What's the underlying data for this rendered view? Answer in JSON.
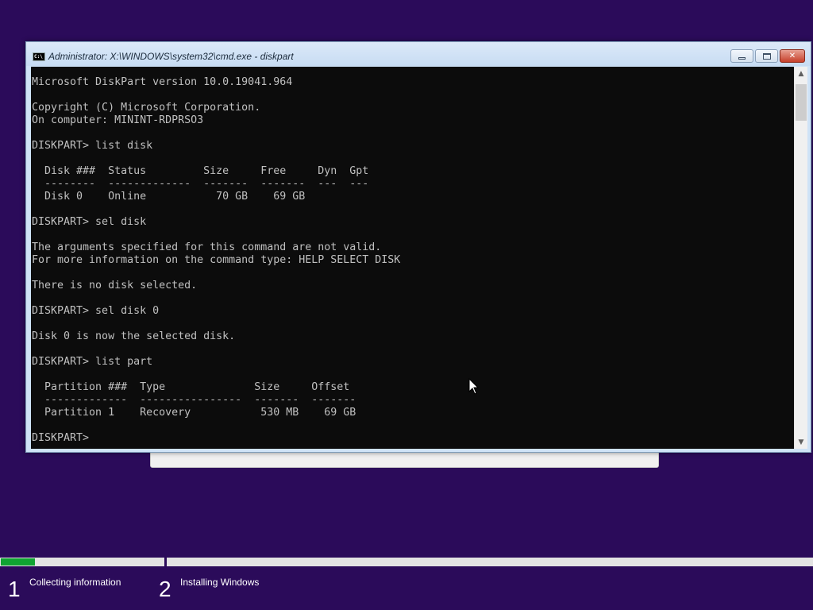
{
  "window": {
    "title": "Administrator: X:\\WINDOWS\\system32\\cmd.exe - diskpart",
    "icon_text": "C:\\",
    "controls": {
      "minimize": "minimize-icon",
      "maximize": "maximize-icon",
      "close": "✕"
    }
  },
  "console": {
    "lines": [
      "Microsoft DiskPart version 10.0.19041.964",
      "",
      "Copyright (C) Microsoft Corporation.",
      "On computer: MININT-RDPRSO3",
      "",
      "DISKPART> list disk",
      "",
      "  Disk ###  Status         Size     Free     Dyn  Gpt",
      "  --------  -------------  -------  -------  ---  ---",
      "  Disk 0    Online           70 GB    69 GB",
      "",
      "DISKPART> sel disk",
      "",
      "The arguments specified for this command are not valid.",
      "For more information on the command type: HELP SELECT DISK",
      "",
      "There is no disk selected.",
      "",
      "DISKPART> sel disk 0",
      "",
      "Disk 0 is now the selected disk.",
      "",
      "DISKPART> list part",
      "",
      "  Partition ###  Type              Size     Offset",
      "  -------------  ----------------  -------  -------",
      "  Partition 1    Recovery           530 MB    69 GB",
      "",
      "DISKPART> "
    ]
  },
  "setup": {
    "progress": {
      "step1_fraction": 0.21,
      "accent": "#10a332"
    },
    "steps": [
      {
        "number": "1",
        "label": "Collecting information"
      },
      {
        "number": "2",
        "label": "Installing Windows"
      }
    ]
  },
  "colors": {
    "desktop": "#2b0b5a",
    "console_bg": "#0c0c0c",
    "console_fg": "#c0c0c0"
  }
}
